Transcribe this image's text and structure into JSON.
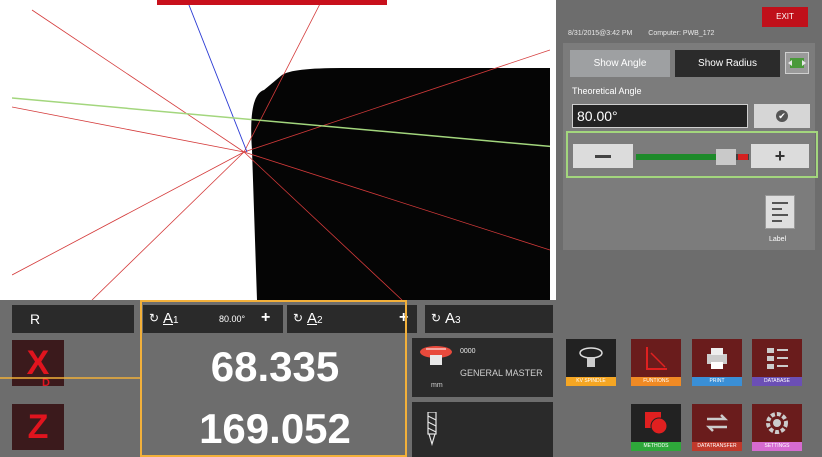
{
  "window": {
    "exit_label": "EXIT"
  },
  "status": {
    "datetime": "8/31/2015@3:42 PM",
    "computer": "Computer: PWB_172"
  },
  "angle_panel": {
    "show_angle_label": "Show Angle",
    "show_radius_label": "Show Radius",
    "theoretical_label": "Theoretical Angle",
    "theoretical_value": "80.00°",
    "slider_level_percent": 72,
    "label_button_text": "Label"
  },
  "measure_header": {
    "r_label": "R",
    "a1_letter": "A",
    "a1_index": "1",
    "a1_value": "80.00°",
    "a2_letter": "A",
    "a2_index": "2",
    "a3_letter": "A",
    "a3_index": "3"
  },
  "axes": {
    "x_label": "X",
    "x_sub": "D",
    "z_label": "Z",
    "x_value": "68.335",
    "z_value": "169.052"
  },
  "tool": {
    "number": "0000",
    "name": "GENERAL MASTER",
    "unit": "mm"
  },
  "function_tiles": [
    {
      "label": "KV SPINDLE",
      "color": "#f5a623"
    },
    {
      "label": "FUNTIONS",
      "color": "#f08a24"
    },
    {
      "label": "PRINT",
      "color": "#3a8fd6"
    },
    {
      "label": "DATABASE",
      "color": "#6b4fb5"
    },
    {
      "label": "METHODS",
      "color": "#2ea83a"
    },
    {
      "label": "DATATRANSFER",
      "color": "#c0392b"
    },
    {
      "label": "SETTINGS",
      "color": "#d66bd0"
    }
  ],
  "colors": {
    "accent_red": "#c0101a",
    "highlight_green": "#a3d67d",
    "highlight_orange": "#f2b03a",
    "panel_gray": "#6d6d6d"
  }
}
